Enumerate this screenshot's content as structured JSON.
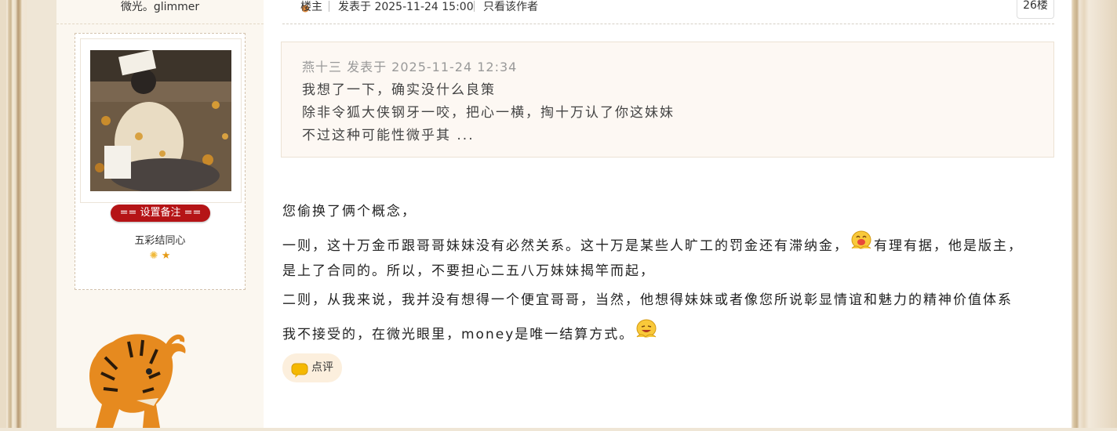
{
  "author": {
    "name": "微光。glimmer",
    "remark_button": "== 设置备注 ==",
    "group": "五彩结同心",
    "rank_icons": [
      "sun-icon",
      "star-icon"
    ]
  },
  "post": {
    "role": "楼主",
    "posted": "发表于 2025-11-24 15:00",
    "only_author": "只看该作者",
    "floor": "26楼",
    "quote": {
      "head": "燕十三 发表于 2025-11-24 12:34",
      "lines": [
        "我想了一下，确实没什么良策",
        "除非令狐大侠钢牙一咬，把心一横，掏十万认了你这妹妹",
        "不过这种可能性微乎其 ..."
      ]
    },
    "body": {
      "line1": "您偷换了俩个概念，",
      "line2a": "一则，这十万金币跟哥哥妹妹没有必然关系。这十万是某些人旷工的罚金还有滞纳金，",
      "line2b": "有理有据，他是版主，",
      "line3": "是上了合同的。所以，不要担心二五八万妹妹揭竿而起，",
      "line4": "二则，从我来说，我并没有想得一个便宜哥哥，当然，他想得妹妹或者像您所说彰显情谊和魅力的精神价值体系",
      "line5": "我不接受的，在微光眼里，money是唯一结算方式。"
    },
    "comment_button": "点评"
  },
  "colors": {
    "accent_red": "#b51416",
    "quote_bg": "#fdf8f3",
    "sidebar_bg": "#fbf7f0"
  }
}
